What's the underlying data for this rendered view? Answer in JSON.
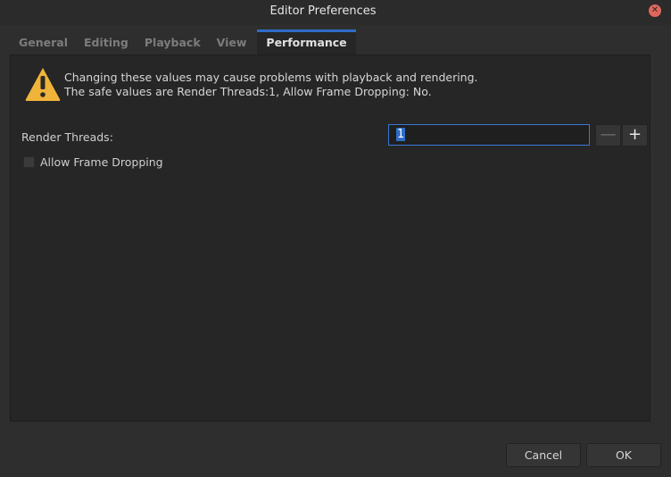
{
  "window": {
    "title": "Editor Preferences",
    "close_glyph": "✕"
  },
  "tabs": [
    {
      "label": "General",
      "active": false
    },
    {
      "label": "Editing",
      "active": false
    },
    {
      "label": "Playback",
      "active": false
    },
    {
      "label": "View",
      "active": false
    },
    {
      "label": "Performance",
      "active": true
    }
  ],
  "warning": {
    "icon": "warning-icon",
    "line1": "Changing these values may cause problems with playback and rendering.",
    "line2": "The safe values are Render Threads:1, Allow Frame Dropping: No."
  },
  "render_threads": {
    "label": "Render Threads:",
    "value": "1",
    "minus_glyph": "—",
    "plus_glyph": "+"
  },
  "allow_frame_dropping": {
    "label": "Allow Frame Dropping",
    "checked": false
  },
  "buttons": {
    "cancel": "Cancel",
    "ok": "OK"
  },
  "colors": {
    "accent": "#2f6cc6",
    "warning": "#f0b43a",
    "close": "#e0675e"
  }
}
